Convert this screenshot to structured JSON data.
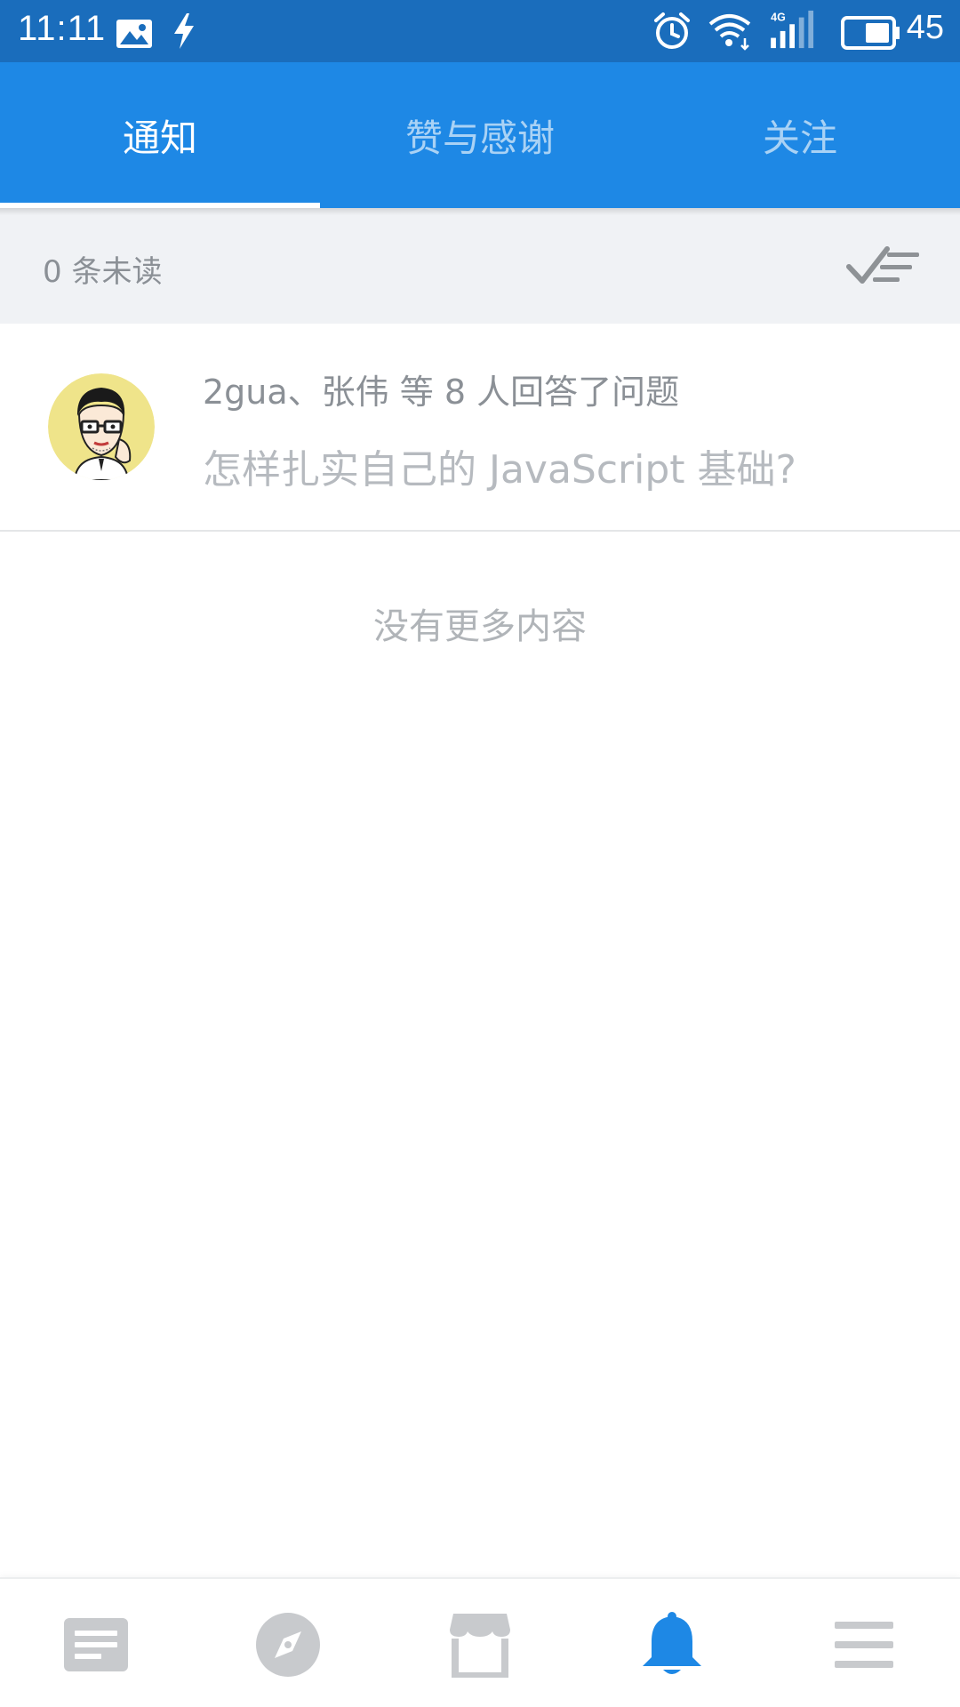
{
  "status_bar": {
    "time": "11:11",
    "network": "4G",
    "battery": "45",
    "icons": [
      "image-icon",
      "flash-icon",
      "alarm-icon",
      "wifi-icon",
      "signal-icon",
      "battery-icon"
    ]
  },
  "tabs": [
    {
      "label": "通知",
      "active": true
    },
    {
      "label": "赞与感谢",
      "active": false
    },
    {
      "label": "关注",
      "active": false
    }
  ],
  "unread": {
    "text": "0 条未读",
    "action_icon": "mark-all-read-icon"
  },
  "notifications": [
    {
      "title": "2gua、张伟 等 8 人回答了问题",
      "subtitle": "怎样扎实自己的 JavaScript 基础?",
      "avatar_icon": "user-avatar"
    }
  ],
  "empty_text": "没有更多内容",
  "bottom_nav": [
    {
      "name": "feed",
      "icon": "article-icon",
      "active": false
    },
    {
      "name": "explore",
      "icon": "compass-icon",
      "active": false
    },
    {
      "name": "market",
      "icon": "store-icon",
      "active": false
    },
    {
      "name": "notifications",
      "icon": "bell-icon",
      "active": true
    },
    {
      "name": "more",
      "icon": "menu-icon",
      "active": false
    }
  ],
  "colors": {
    "status_bar": "#1a6dbc",
    "primary": "#1e88e5",
    "inactive_icon": "#c8cacd",
    "text_muted": "#8b9096"
  }
}
